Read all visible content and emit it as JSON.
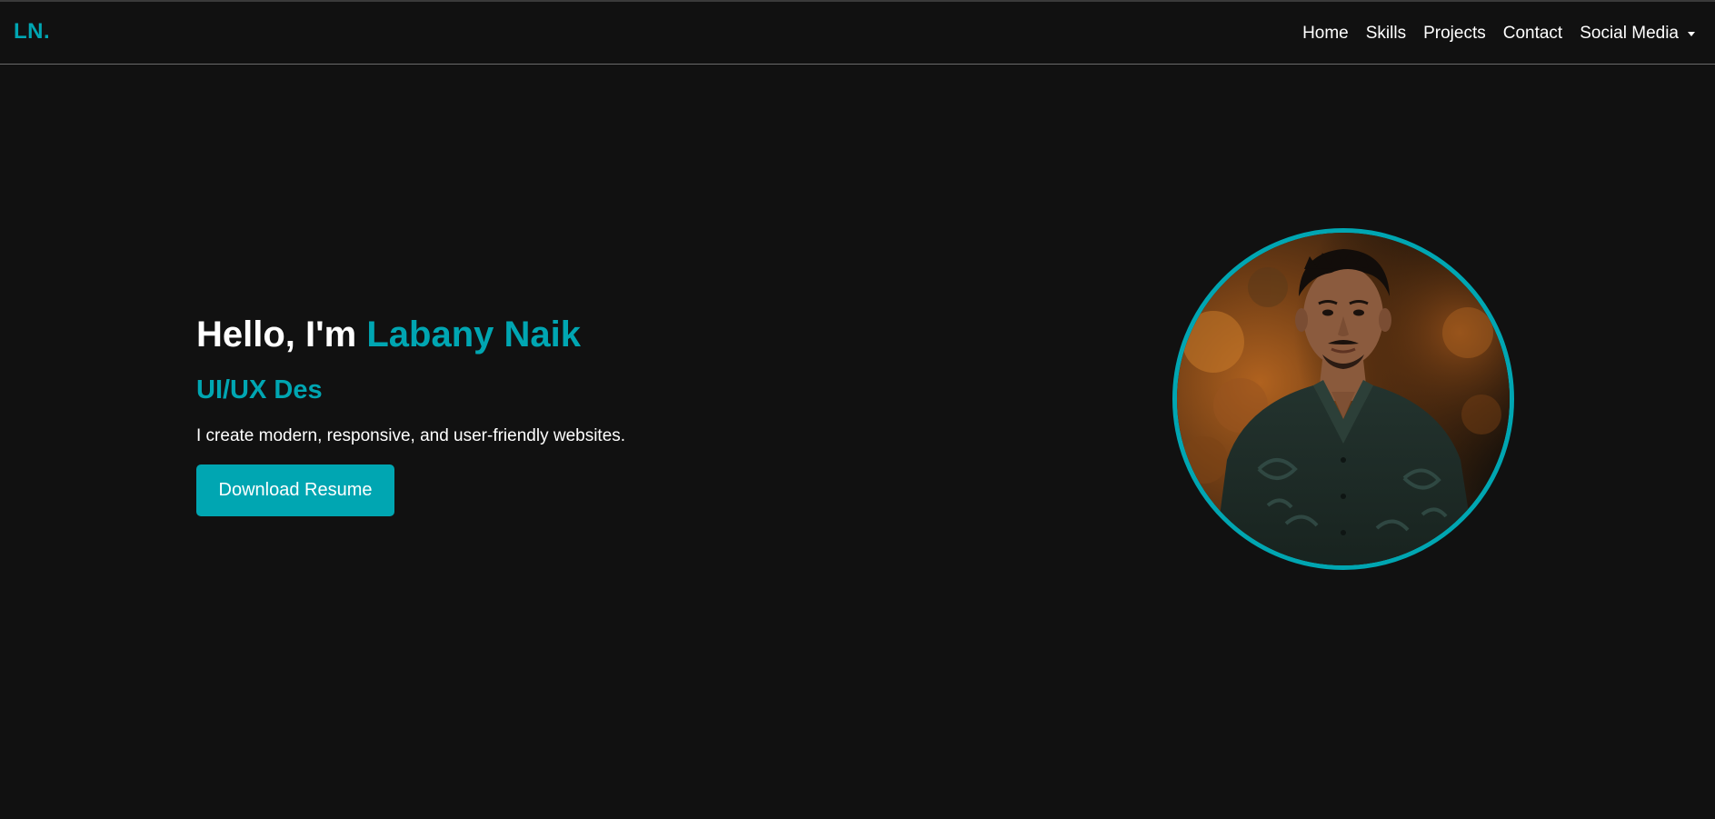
{
  "brand": {
    "logo_text": "LN.",
    "accent_color": "#00a6b2",
    "background_color": "#111111"
  },
  "nav": {
    "items": [
      {
        "label": "Home"
      },
      {
        "label": "Skills"
      },
      {
        "label": "Projects"
      },
      {
        "label": "Contact"
      }
    ],
    "dropdown": {
      "label": "Social Media",
      "icon": "caret-down-icon"
    }
  },
  "hero": {
    "greeting": "Hello, I'm ",
    "name": "Labany Naik",
    "role": "UI/UX Des",
    "description": "I create modern, responsive, and user-friendly websites.",
    "button_label": "Download Resume"
  },
  "profile_image": {
    "subject": "portrait-photo"
  }
}
